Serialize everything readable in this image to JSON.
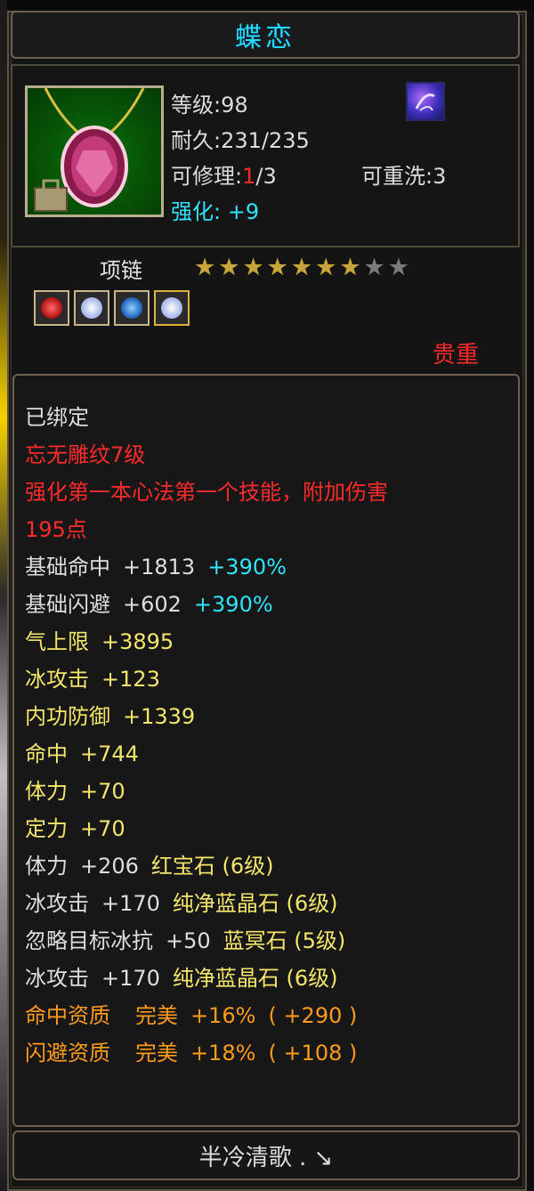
{
  "title": "蝶恋",
  "info": {
    "level_label": "等级:98",
    "durability_label": "耐久:231/235",
    "repair_prefix": "可修理:",
    "repair_used": "1",
    "repair_total": "/3",
    "rewash_label": "可重洗:3",
    "enhance_prefix": "强化:",
    "enhance_value": "+9"
  },
  "item_type": "项链",
  "stars": {
    "filled": 7,
    "total": 9
  },
  "gems": [
    {
      "icon": "red-gem-icon",
      "color": "#d81d1d"
    },
    {
      "icon": "white-gem-icon",
      "color": "#dfe6ff"
    },
    {
      "icon": "blue-gem-icon",
      "color": "#2a7bd8"
    },
    {
      "icon": "white-gem-icon",
      "color": "#dfe6ff"
    }
  ],
  "rarity": "贵重",
  "description": {
    "bound": "已绑定",
    "engrave": "忘无雕纹7级",
    "skill_line1": "强化第一本心法第一个技能，附加伤害",
    "skill_line2": "195点",
    "base_hit": {
      "label": "基础命中",
      "value": "+1813",
      "pct": "+390%"
    },
    "base_dodge": {
      "label": "基础闪避",
      "value": "+602",
      "pct": "+390%"
    },
    "stats": [
      {
        "label": "气上限",
        "value": "+3895"
      },
      {
        "label": "冰攻击",
        "value": "+123"
      },
      {
        "label": "内功防御",
        "value": "+1339"
      },
      {
        "label": "命中",
        "value": "+744"
      },
      {
        "label": "体力",
        "value": "+70"
      },
      {
        "label": "定力",
        "value": "+70"
      }
    ],
    "gem_stats": [
      {
        "label": "体力",
        "value": "+206",
        "source": "红宝石 (6级)"
      },
      {
        "label": "冰攻击",
        "value": "+170",
        "source": "纯净蓝晶石 (6级)"
      },
      {
        "label": "忽略目标冰抗",
        "value": "+50",
        "source": "蓝冥石 (5级)"
      },
      {
        "label": "冰攻击",
        "value": "+170",
        "source": "纯净蓝晶石 (6级)"
      }
    ],
    "aptitudes": [
      {
        "label": "命中资质",
        "grade": "完美",
        "pct": "+16%",
        "extra": "( +290 )"
      },
      {
        "label": "闪避资质",
        "grade": "完美",
        "pct": "+18%",
        "extra": "( +108 )"
      }
    ]
  },
  "owner": "半冷清歌 . ↘"
}
